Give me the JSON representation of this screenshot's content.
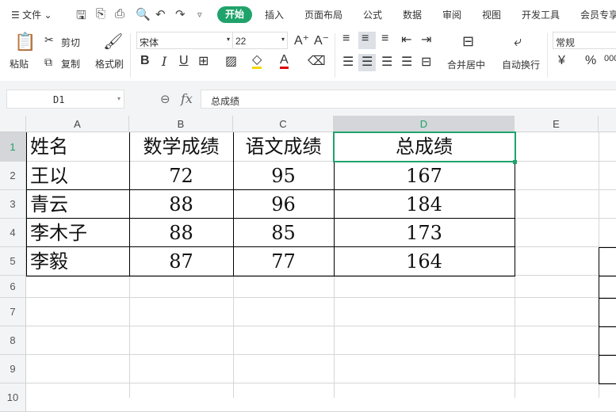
{
  "menu": {
    "file": "文件",
    "tabs": [
      "开始",
      "插入",
      "页面布局",
      "公式",
      "数据",
      "审阅",
      "视图",
      "开发工具",
      "会员专享"
    ]
  },
  "toolbar": {
    "paste": "粘贴",
    "cut": "剪切",
    "copy": "复制",
    "format_painter": "格式刷",
    "font": "宋体",
    "font_size": "22",
    "merge": "合并居中",
    "wrap": "自动换行",
    "number_format": "常规",
    "currency": "¥",
    "percent": "%"
  },
  "formula_bar": {
    "cell_ref": "D1",
    "fx": "fx",
    "value": "总成绩"
  },
  "sheet": {
    "columns": [
      "A",
      "B",
      "C",
      "D",
      "E"
    ],
    "rows": [
      "1",
      "2",
      "3",
      "4",
      "5",
      "6",
      "7",
      "8",
      "9",
      "10"
    ],
    "selected": "D1",
    "accent": "#1fa36b",
    "data": [
      [
        "姓名",
        "数学成绩",
        "语文成绩",
        "总成绩"
      ],
      [
        "王以",
        "72",
        "95",
        "167"
      ],
      [
        "青云",
        "88",
        "96",
        "184"
      ],
      [
        "李木子",
        "88",
        "85",
        "173"
      ],
      [
        "李毅",
        "87",
        "77",
        "164"
      ]
    ]
  }
}
